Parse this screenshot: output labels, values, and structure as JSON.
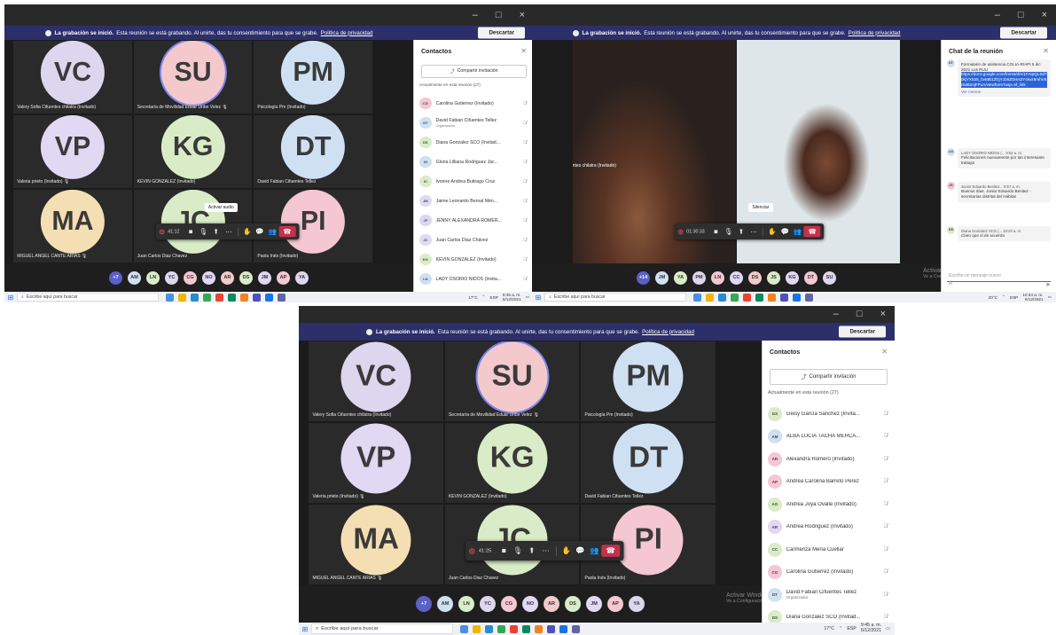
{
  "colors": {
    "accent": "#5b5fc7",
    "banner": "#2d2f6a",
    "hangup": "#c4314b",
    "stage": "#1b1b1b"
  },
  "banner": {
    "bold": "La grabación se inició.",
    "text": "Esta reunión se está grabando. Al unirte, das tu consentimiento para que se grabe.",
    "link": "Política de privacidad",
    "dismiss": "Descartar"
  },
  "window": {
    "minimize": "–",
    "maximize": "□",
    "close": "×"
  },
  "grid_tiles": [
    {
      "initials": "VC",
      "name": "Valery Sofia Cifuentes chilatra (Invitado)",
      "color": "#dcd6ef"
    },
    {
      "initials": "SU",
      "name": "Secretaría de Movilidad Eduar Uribe Velez 🎙",
      "color": "#f3c9cb"
    },
    {
      "initials": "PM",
      "name": "Psicología Pm (Invitado)",
      "color": "#cfe0f3"
    },
    {
      "initials": "VP",
      "name": "Valeria prieto (Invitado) 🎙",
      "color": "#e1d8f3"
    },
    {
      "initials": "KG",
      "name": "KEVIN GONZALEZ (Invitado)",
      "color": "#d9ecc7"
    },
    {
      "initials": "DT",
      "name": "David Fabian Cifuentes Tellez",
      "color": "#cfe0f3"
    },
    {
      "initials": "MA",
      "name": "MIGUEL ANGEL CANTE ARIAS 🎙",
      "color": "#f3dfb3"
    },
    {
      "initials": "JC",
      "name": "Juan Carlos Diaz Chavez",
      "color": "#d9ecc7"
    },
    {
      "initials": "PI",
      "name": "Paola Inés (Invitado)",
      "color": "#f4c7d3"
    }
  ],
  "tl": {
    "time": "41:12",
    "tooltip": "Activar audio",
    "tray_more": "+7",
    "tray": [
      "AM",
      "LN",
      "YC",
      "CG",
      "NO",
      "AR",
      "DS",
      "JM",
      "AP",
      "YA"
    ],
    "panel": {
      "title": "Contactos",
      "share": "Compartir invitación",
      "section": "Actualmente en esta reunión (27)",
      "people": [
        {
          "i": "CG",
          "n": "Carolina Gutierrez (Invitado)",
          "s": "",
          "c": "#f4c7d3"
        },
        {
          "i": "DT",
          "n": "David Fabian Cifuentes Tellez",
          "s": "Organizador",
          "c": "#cfe0f3"
        },
        {
          "i": "DS",
          "n": "Diana Gonzalez SCO (Invitad...",
          "s": "",
          "c": "#d9ecc7"
        },
        {
          "i": "GI",
          "n": "Gloria Lilliana Rodriguez Jác...",
          "s": "",
          "c": "#cfe0f3"
        },
        {
          "i": "IC",
          "n": "Ivonne Andrea Buitrago Cruz",
          "s": "",
          "c": "#d9ecc7"
        },
        {
          "i": "JM",
          "n": "Jaime Leonardo Bernal Mén...",
          "s": "",
          "c": "#e1d8f3"
        },
        {
          "i": "JF",
          "n": "JENNY ALEXANDRA ROMER...",
          "s": "",
          "c": "#dcd6ef"
        },
        {
          "i": "JC",
          "n": "Juan Carlos Díaz Chávez",
          "s": "",
          "c": "#e1d8f3"
        },
        {
          "i": "KG",
          "n": "KEVIN GONZALEZ (Invitado)",
          "s": "",
          "c": "#d9ecc7"
        },
        {
          "i": "LN",
          "n": "LADY OSORIO NIDOS (Invita...",
          "s": "",
          "c": "#cfe0f3"
        }
      ]
    },
    "taskbar": {
      "search": "Escribe aquí para buscar",
      "weather": "17°C",
      "lang": "ESP",
      "time": "9:45 a. m.",
      "date": "6/12/2021"
    }
  },
  "tr": {
    "time": "01:30:33",
    "tooltip": "Silenciar",
    "video_left_name": "Valery Sofia Cifuentes chilatra (Invitado)",
    "tray_more": "+14",
    "tray": [
      "JM",
      "YA",
      "PM",
      "LN",
      "CC",
      "DS",
      "JS",
      "KG",
      "DT",
      "SU"
    ],
    "panel": {
      "title": "Chat de la reunión",
      "msgs": [
        {
          "i": "DT",
          "c": "#cfe0f3",
          "head": "",
          "body": "Formulario de asistencia COLIA-RIAPI 6 dic 2021 Los RUU",
          "link": "https://docs.google.com/forms/d/e/1FAIpQLSd70kjYX535_bvMB12fzjY1b6ZDms3Y4Iwz8mhV8nlx6bmjFPuA/viewform?usp=sf_link",
          "foot": "Ver menos"
        },
        {
          "i": "LN",
          "c": "#cfe0f3",
          "head": "LADY OSORIO NIDOS (... 9:52 a. m.",
          "body": "Felicitaciones nuevamente por tan interesante trabajo!"
        },
        {
          "i": "JS",
          "c": "#f4c7d3",
          "head": "Junior Eduardo Benitez... 9:57 a. m.",
          "body": "Buenos días. Junior Eduardo Benitez - secretarías distrital del Hábitat"
        },
        {
          "i": "DS",
          "c": "#d9ecc7",
          "head": "Diana Gonzalez SCO (... 10:23 a. m.",
          "body": "Claro que sí de acuerdo"
        }
      ],
      "composer": "Escribe un mensaje nuevo"
    },
    "watermark": [
      "Activar Windows",
      "Ve a Configuración para activar Windows."
    ],
    "taskbar": {
      "search": "Escribe aquí para buscar",
      "weather": "20°C",
      "lang": "ESP",
      "time": "10:34 a. m.",
      "date": "6/12/2021"
    }
  },
  "bot": {
    "time": "41:25",
    "tray_more": "+7",
    "tray": [
      "AM",
      "LN",
      "YC",
      "CG",
      "NO",
      "AR",
      "DS",
      "JM",
      "AP",
      "YA"
    ],
    "panel": {
      "title": "Contactos",
      "share": "Compartir invitación",
      "section": "Actualmente en esta reunión (27)",
      "people": [
        {
          "i": "GS",
          "n": "Geisy García Sánchez (Invita...",
          "s": "",
          "c": "#d9ecc7"
        },
        {
          "i": "AM",
          "n": "ALBA LUCIA TACHA MERCA...",
          "s": "",
          "c": "#cfe0f3"
        },
        {
          "i": "AR",
          "n": "Alexandra Romero (Invitado)",
          "s": "",
          "c": "#f4c7d3"
        },
        {
          "i": "AP",
          "n": "Andrea Carolina Barreto Perez",
          "s": "",
          "c": "#f4c7d3"
        },
        {
          "i": "AO",
          "n": "Andrea Joya Ovalle (Invitado)",
          "s": "",
          "c": "#d9ecc7"
        },
        {
          "i": "AR",
          "n": "Andrea Rodriguez (Invitado)",
          "s": "",
          "c": "#e1d8f3"
        },
        {
          "i": "CC",
          "n": "Carmenza Mena Cuellar",
          "s": "",
          "c": "#d9ecc7"
        },
        {
          "i": "CG",
          "n": "Carolina Gutierrez (Invitado)",
          "s": "",
          "c": "#f4c7d3"
        },
        {
          "i": "DT",
          "n": "David Fabian Cifuentes Tellez",
          "s": "Organizador",
          "c": "#cfe0f3"
        },
        {
          "i": "DS",
          "n": "Diana González SCO (Invitad...",
          "s": "",
          "c": "#d9ecc7"
        }
      ]
    },
    "watermark": [
      "Activar Windows",
      "Ve a Configuración para activar Windows."
    ],
    "taskbar": {
      "search": "Escribe aquí para buscar",
      "weather": "17°C",
      "lang": "ESP",
      "time": "9:45 a. m.",
      "date": "6/12/2021"
    }
  }
}
